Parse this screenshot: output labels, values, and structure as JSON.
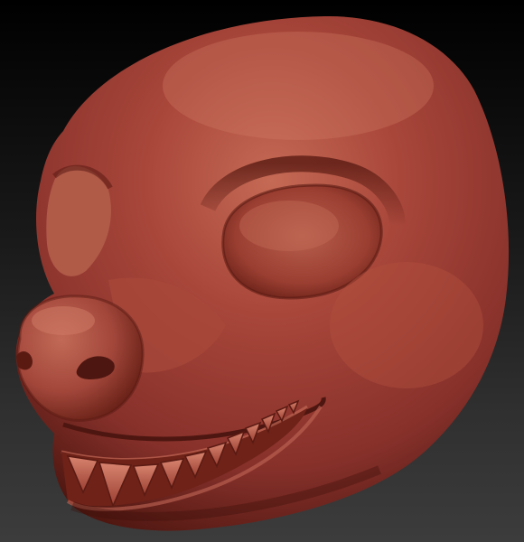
{
  "scene": {
    "subject": "sculpted-creature-head",
    "material_color": "#9a3a2c",
    "highlight_color": "#c9705c",
    "shadow_color": "#4e1610",
    "background_top": "#000000",
    "background_bottom": "#3c3c3c"
  }
}
